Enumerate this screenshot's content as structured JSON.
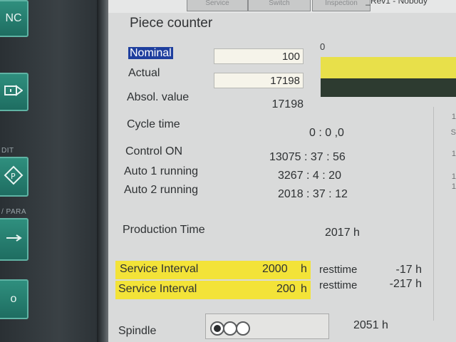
{
  "bezel": {
    "key_top_label": "NC",
    "key2_icon": "play-triangle-icon",
    "edit_label": "DIT",
    "key3_icon": "program-diamond-icon",
    "para_label": "/ PARA",
    "key4_icon": "arrow-right-icon",
    "key5_label": "o"
  },
  "window": {
    "title": "_Rev1 - Nobody",
    "tabs": [
      "Service",
      "Switch",
      "Inspection"
    ]
  },
  "piece_counter": {
    "heading": "Piece counter",
    "nominal_label": "Nominal",
    "nominal_value": "100",
    "actual_label": "Actual",
    "actual_value": "17198",
    "absol_label": "Absol. value",
    "absol_value": "17198",
    "bar_scale_label": "0",
    "bar_nominal_color": "#e8e04a",
    "bar_actual_color": "#2d3b30"
  },
  "times": {
    "cycle_label": "Cycle time",
    "cycle_value": "0 : 0 ,0",
    "control_label": "Control ON",
    "control_value": "13075 : 37 : 56",
    "auto1_label": "Auto 1 running",
    "auto1_value": "3267 : 4 : 20",
    "auto2_label": "Auto 2 running",
    "auto2_value": "2018 : 37 : 12",
    "production_label": "Production Time",
    "production_value": "2017 h"
  },
  "service": {
    "highlight_color": "#f3e338",
    "rows": [
      {
        "label": "Service Interval",
        "value": "2000",
        "unit": "h",
        "rest_label": "resttime",
        "rest_value": "-17 h"
      },
      {
        "label": "Service Interval",
        "value": "200",
        "unit": "h",
        "rest_label": "resttime",
        "rest_value": "-217 h"
      }
    ]
  },
  "spindle": {
    "label": "Spindle",
    "value": "2051 h",
    "selector_icon": "three-position-selector-icon",
    "active_position": 1
  },
  "right_column": [
    "1",
    "S",
    "1",
    "1",
    "1"
  ]
}
